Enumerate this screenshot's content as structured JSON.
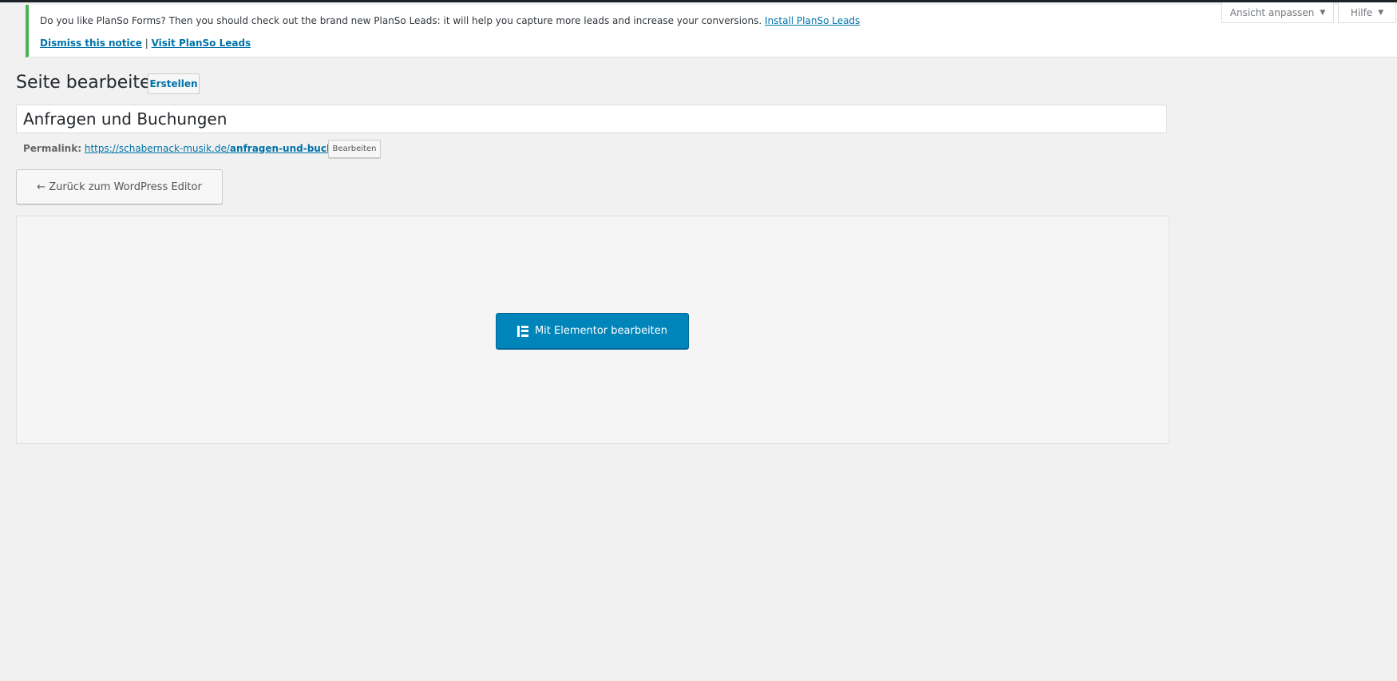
{
  "screen_options": {
    "ansicht_label": "Ansicht anpassen",
    "hilfe_label": "Hilfe"
  },
  "notice": {
    "text": "Do you like PlanSo Forms? Then you should check out the brand new PlanSo Leads: it will help you capture more leads and increase your conversions.",
    "install_link": "Install PlanSo Leads",
    "dismiss_link": "Dismiss this notice",
    "separator": "|",
    "visit_link": "Visit PlanSo Leads",
    "accent_color": "#46b450"
  },
  "page": {
    "title": "Seite bearbeiten",
    "create_button": "Erstellen",
    "post_title_value": "Anfragen und Buchungen",
    "permalink_label": "Permalink:",
    "permalink_base": "https://schabernack-musik.de/",
    "permalink_slug": "anfragen-und-buchungen",
    "permalink_trailing": "/",
    "permalink_edit_button": "Bearbeiten",
    "back_button": "← Zurück zum WordPress Editor",
    "elementor_button": "Mit Elementor bearbeiten",
    "elementor_icon": "elementor-icon",
    "elementor_color": "#0085ba"
  }
}
